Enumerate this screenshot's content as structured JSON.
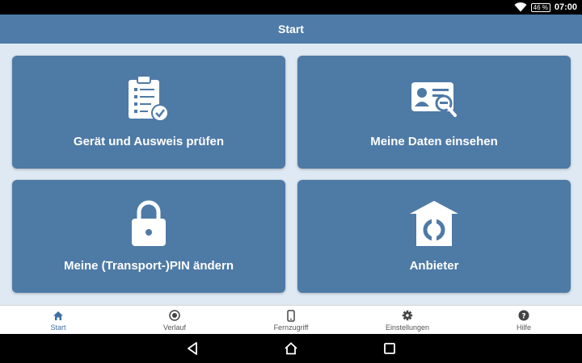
{
  "status_bar": {
    "battery": "46 %",
    "time": "07:00"
  },
  "app_bar": {
    "title": "Start"
  },
  "tiles": [
    {
      "label": "Gerät und Ausweis prüfen",
      "icon": "checklist-icon"
    },
    {
      "label": "Meine Daten einsehen",
      "icon": "id-card-search-icon"
    },
    {
      "label": "Meine (Transport-)PIN ändern",
      "icon": "lock-icon"
    },
    {
      "label": "Anbieter",
      "icon": "provider-house-icon"
    }
  ],
  "bottom_nav": {
    "active": "Start",
    "items": [
      {
        "label": "Start",
        "icon": "home-icon"
      },
      {
        "label": "Verlauf",
        "icon": "history-icon"
      },
      {
        "label": "Fernzugriff",
        "icon": "smartphone-icon"
      },
      {
        "label": "Einstellungen",
        "icon": "gear-icon"
      },
      {
        "label": "Hilfe",
        "icon": "help-icon"
      }
    ]
  },
  "system_nav": [
    "back-icon",
    "home-circle-icon",
    "recents-icon"
  ],
  "colors": {
    "primary": "#4e7ba8",
    "tile": "#4e7aa6",
    "background": "#dfe9f3",
    "active_nav": "#3e6fa3"
  }
}
